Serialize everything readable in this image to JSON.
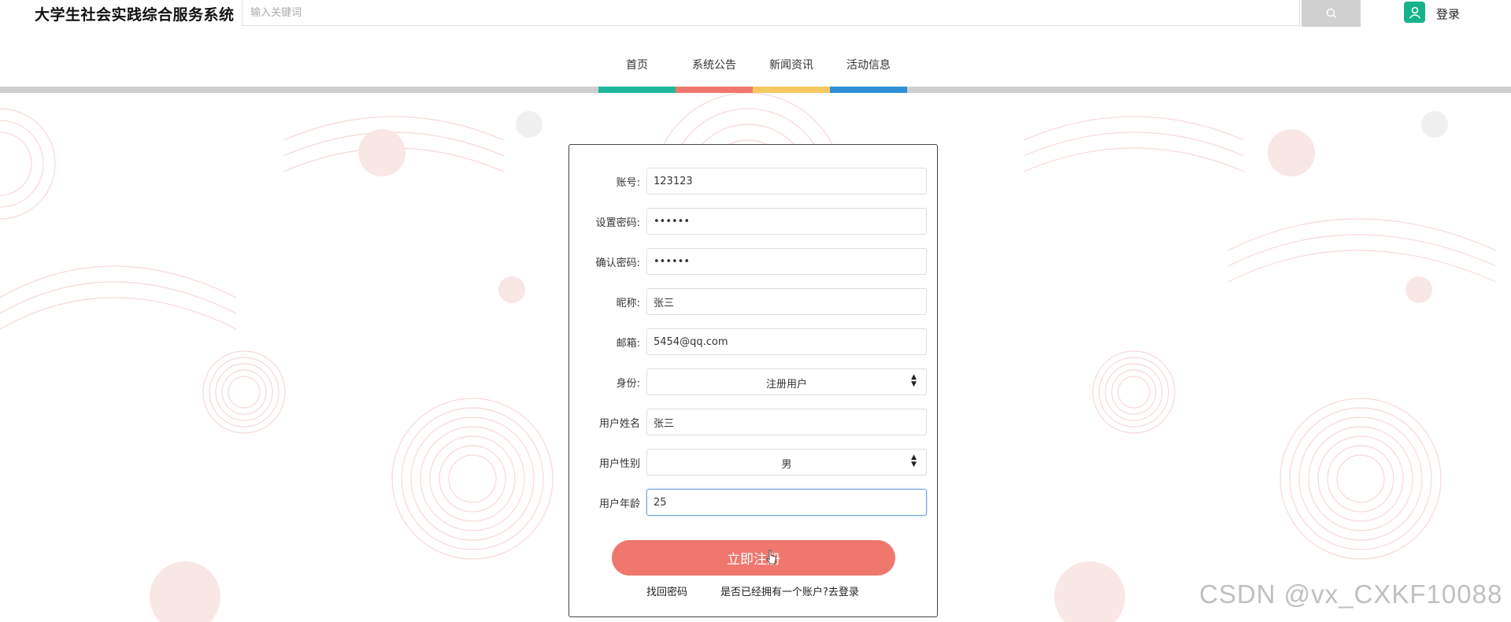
{
  "header": {
    "site_title": "大学生社会实践综合服务系统",
    "search_placeholder": "输入关键词",
    "login_label": "登录"
  },
  "nav": {
    "items": [
      {
        "label": "首页",
        "color": "#1fb79a"
      },
      {
        "label": "系统公告",
        "color": "#ef776d"
      },
      {
        "label": "新闻资讯",
        "color": "#f6c860"
      },
      {
        "label": "活动信息",
        "color": "#2d8fd6"
      }
    ]
  },
  "form": {
    "fields": [
      {
        "label": "账号:",
        "value": "123123"
      },
      {
        "label": "设置密码:",
        "value": "••••••"
      },
      {
        "label": "确认密码:",
        "value": "••••••"
      },
      {
        "label": "昵称:",
        "value": "张三"
      },
      {
        "label": "邮箱:",
        "value": "5454@qq.com"
      },
      {
        "label": "身份:",
        "value": "注册用户"
      },
      {
        "label": "用户姓名",
        "value": "张三"
      },
      {
        "label": "用户性别",
        "value": "男"
      },
      {
        "label": "用户年龄",
        "value": "25"
      }
    ],
    "submit_label": "立即注册",
    "forgot_label": "找回密码",
    "login_link_label": "是否已经拥有一个账户?去登录"
  },
  "watermark": "CSDN @vx_CXKF10088",
  "colors": {
    "accent": "#ef776d",
    "user_badge": "#16b38a",
    "pattern": "#f6d9d6"
  },
  "icons": {
    "search": "search-icon",
    "user": "user-icon",
    "caret": "select-caret-icon",
    "cursor": "cursor-icon"
  }
}
